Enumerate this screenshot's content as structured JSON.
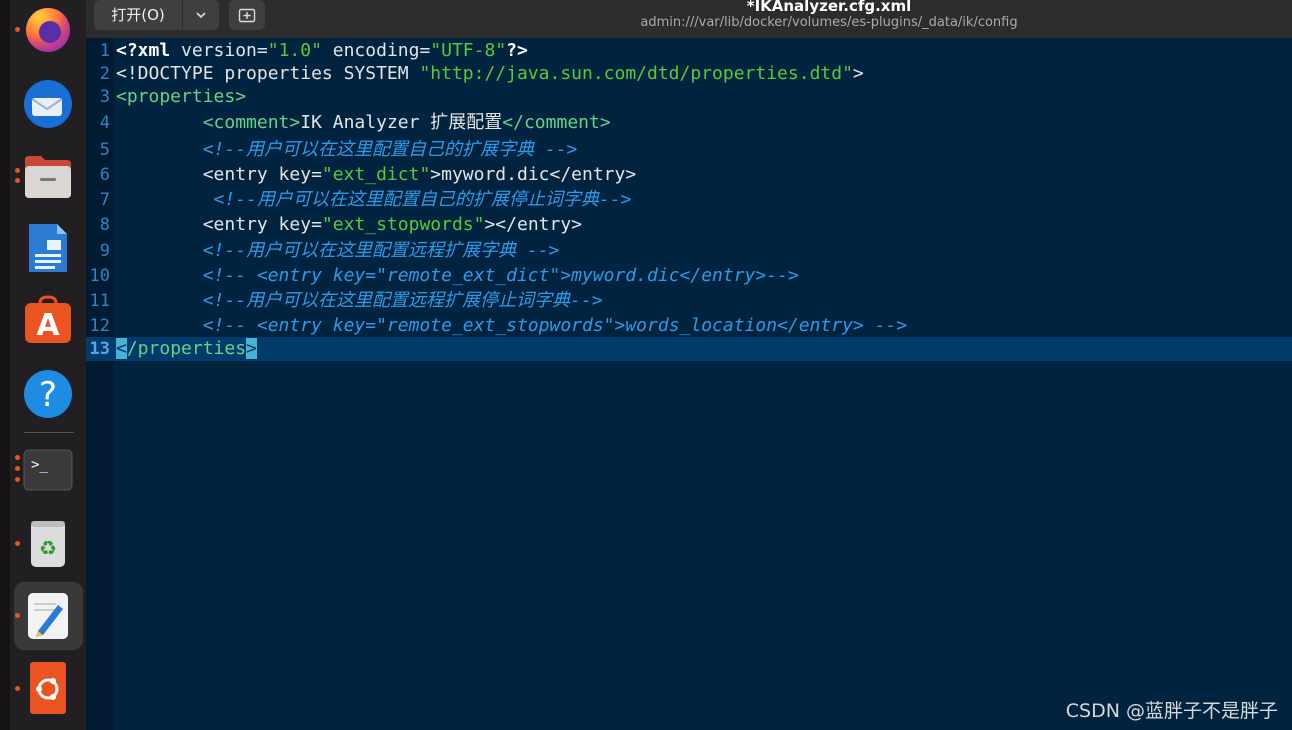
{
  "header": {
    "open_button": "打开(O)",
    "title": "*IKAnalyzer.cfg.xml",
    "subtitle": "admin:///var/lib/docker/volumes/es-plugins/_data/ik/config"
  },
  "dock": {
    "apps": [
      "firefox-icon",
      "thunderbird-icon",
      "files-icon",
      "libreoffice-writer-icon",
      "app-center-icon",
      "help-icon",
      "terminal-icon",
      "trash-icon",
      "text-editor-icon",
      "ubuntu-icon"
    ]
  },
  "editor": {
    "current_line": 13,
    "lines": [
      {
        "n": "1",
        "segs": [
          [
            "pi",
            "<?xml"
          ],
          [
            "txt",
            " version="
          ],
          [
            "val",
            "\"1.0\""
          ],
          [
            "txt",
            " encoding="
          ],
          [
            "val",
            "\"UTF-8\""
          ],
          [
            "pi",
            "?>"
          ]
        ]
      },
      {
        "n": "2",
        "segs": [
          [
            "txt",
            "<!DOCTYPE properties SYSTEM "
          ],
          [
            "val",
            "\"http://java.sun.com/dtd/properties.dtd\""
          ],
          [
            "txt",
            ">"
          ]
        ]
      },
      {
        "n": "3",
        "segs": [
          [
            "tag",
            "<properties>"
          ]
        ]
      },
      {
        "n": "4",
        "segs": [
          [
            "txt",
            "        "
          ],
          [
            "tag",
            "<comment>"
          ],
          [
            "txt",
            "IK Analyzer 扩展配置"
          ],
          [
            "tag",
            "</comment>"
          ]
        ]
      },
      {
        "n": "5",
        "segs": [
          [
            "txt",
            "        "
          ],
          [
            "comment",
            "<!--用户可以在这里配置自己的扩展字典 -->"
          ]
        ]
      },
      {
        "n": "6",
        "segs": [
          [
            "txt",
            "        <entry key="
          ],
          [
            "val",
            "\"ext_dict\""
          ],
          [
            "txt",
            ">myword.dic</entry>"
          ]
        ]
      },
      {
        "n": "7",
        "segs": [
          [
            "txt",
            "         "
          ],
          [
            "comment",
            "<!--用户可以在这里配置自己的扩展停止词字典-->"
          ]
        ]
      },
      {
        "n": "8",
        "segs": [
          [
            "txt",
            "        <entry key="
          ],
          [
            "val",
            "\"ext_stopwords\""
          ],
          [
            "txt",
            "></entry>"
          ]
        ]
      },
      {
        "n": "9",
        "segs": [
          [
            "txt",
            "        "
          ],
          [
            "comment",
            "<!--用户可以在这里配置远程扩展字典 -->"
          ]
        ]
      },
      {
        "n": "10",
        "segs": [
          [
            "txt",
            "        "
          ],
          [
            "comment",
            "<!-- <entry key=\"remote_ext_dict\">myword.dic</entry>-->"
          ]
        ]
      },
      {
        "n": "11",
        "segs": [
          [
            "txt",
            "        "
          ],
          [
            "comment",
            "<!--用户可以在这里配置远程扩展停止词字典-->"
          ]
        ]
      },
      {
        "n": "12",
        "segs": [
          [
            "txt",
            "        "
          ],
          [
            "comment",
            "<!-- <entry key=\"remote_ext_stopwords\">words_location</entry> -->"
          ]
        ]
      },
      {
        "n": "13",
        "segs": [
          [
            "hl",
            "<"
          ],
          [
            "tag",
            "/properties"
          ],
          [
            "hl",
            ">"
          ]
        ]
      }
    ]
  },
  "watermark": "CSDN @蓝胖子不是胖子"
}
